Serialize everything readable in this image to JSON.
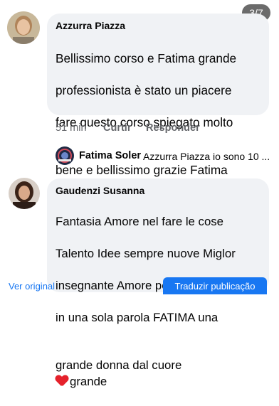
{
  "page_counter": "3/7",
  "comments": [
    {
      "author": "Azzurra Piazza",
      "lines": [
        "Bellissimo corso e Fatima grande",
        "professionista è  stato un piacere",
        "fare questo corso spiegato molto",
        "bene e bellissimo grazie Fatima"
      ],
      "time": "51 min",
      "action_like": "Curtir",
      "action_reply": "Responder"
    },
    {
      "author": "Gaudenzi Susanna",
      "lines": [
        "Fantasia Amore nel fare le cose",
        "Talento  Idee sempre  nuove Miglor",
        "insegnante    Amore per  insegnare....",
        "in una sola parola FATIMA una",
        "grande donna  dal cuore"
      ],
      "line_tail": "grande"
    }
  ],
  "reply_preview": {
    "author": "Fatima Soler",
    "text": "Azzurra Piazza io sono 10 ..."
  },
  "emoji_names": [
    "face-blowing-kiss-icon",
    "red-heart-icon"
  ],
  "colors": {
    "bubble": "#f0f2f5",
    "link": "#1877f2",
    "badge": "#6b6b6b"
  },
  "bottom_bar": {
    "left_link": "Ver original",
    "right_button": "Traduzir publicação"
  }
}
